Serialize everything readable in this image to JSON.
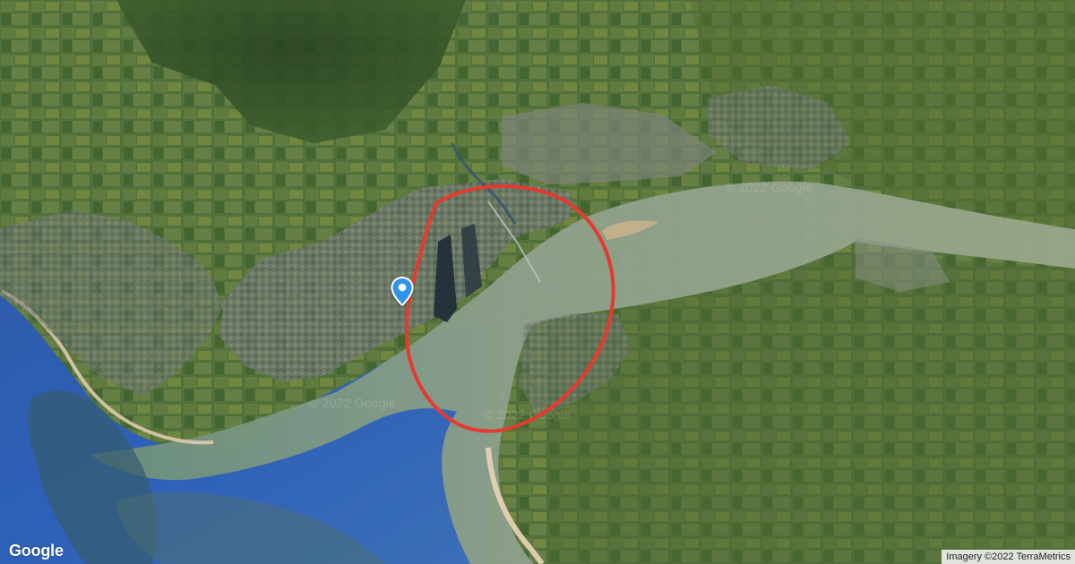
{
  "map": {
    "watermarks": [
      "© 2022 Google",
      "© 2022 Google",
      "© 2022 Google"
    ],
    "logo": "Google",
    "attribution": "Imagery ©2022 TerraMetrics",
    "highlight_color": "#e53a2f",
    "marker_color": "#2f95ea",
    "icons": {
      "marker": "location-pin-icon"
    }
  }
}
